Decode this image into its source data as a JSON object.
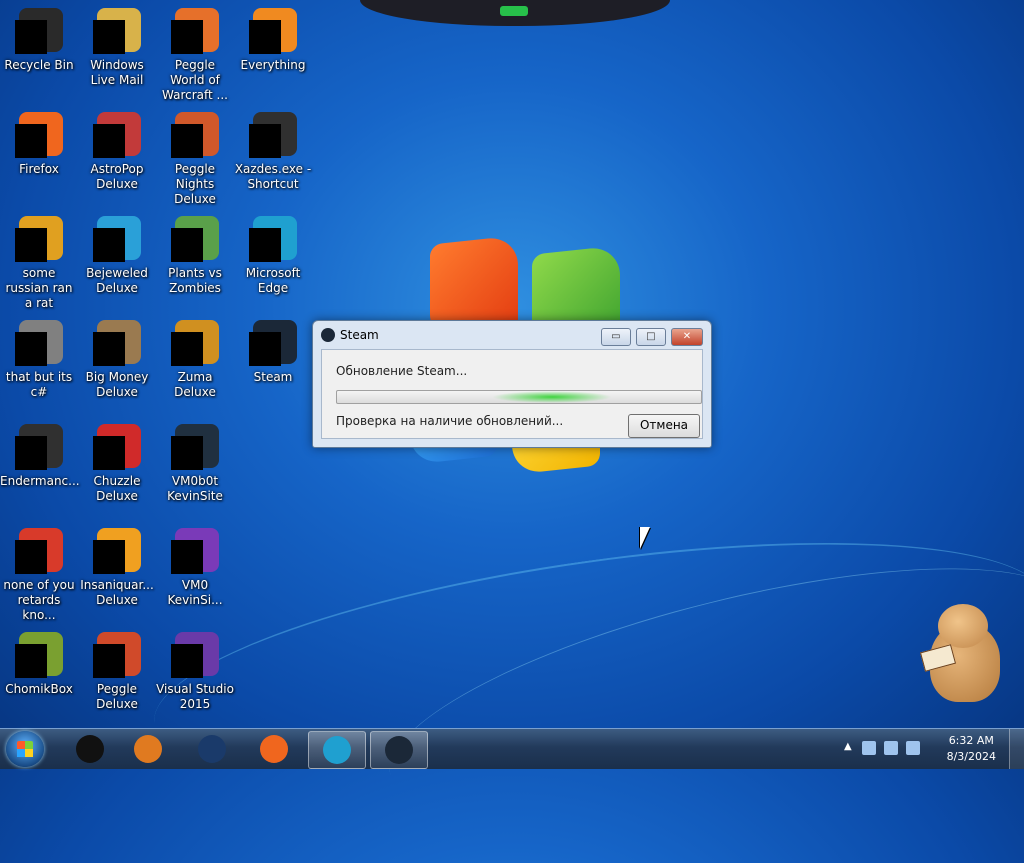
{
  "desktop_icons": [
    {
      "label": "Recycle Bin",
      "color": "#2a2a2a",
      "icon": "recycle-bin"
    },
    {
      "label": "Windows Live Mail",
      "color": "#d8b24a",
      "icon": "mail"
    },
    {
      "label": "Peggle World of Warcraft ...",
      "color": "#e6702a",
      "icon": "peggle"
    },
    {
      "label": "Everything",
      "color": "#f08a20",
      "icon": "everything"
    },
    {
      "label": "Firefox",
      "color": "#f0661e",
      "icon": "firefox"
    },
    {
      "label": "AstroPop Deluxe",
      "color": "#c23a3a",
      "icon": "astropop"
    },
    {
      "label": "Peggle Nights Deluxe",
      "color": "#d0582a",
      "icon": "peggle-nights"
    },
    {
      "label": "Xazdes.exe - Shortcut",
      "color": "#303030",
      "icon": "shortcut"
    },
    {
      "label": "some russian ran a rat",
      "color": "#e0a020",
      "icon": "file"
    },
    {
      "label": "Bejeweled Deluxe",
      "color": "#2aa0d8",
      "icon": "bejeweled"
    },
    {
      "label": "Plants vs Zombies",
      "color": "#5aa04a",
      "icon": "pvz"
    },
    {
      "label": "Microsoft Edge",
      "color": "#1fa0d0",
      "icon": "edge"
    },
    {
      "label": "that but its c#",
      "color": "#808080",
      "icon": "file"
    },
    {
      "label": "Big Money Deluxe",
      "color": "#9a7a50",
      "icon": "bigmoney"
    },
    {
      "label": "Zuma Deluxe",
      "color": "#d09020",
      "icon": "zuma"
    },
    {
      "label": "Steam",
      "color": "#1b2838",
      "icon": "steam"
    },
    {
      "label": "Endermanc...",
      "color": "#303030",
      "icon": "console"
    },
    {
      "label": "Chuzzle Deluxe",
      "color": "#d02a2a",
      "icon": "chuzzle"
    },
    {
      "label": "VM0b0t KevinSite",
      "color": "#203040",
      "icon": "vm"
    },
    {
      "label": "",
      "color": "transparent",
      "icon": "none"
    },
    {
      "label": "none of you retards kno...",
      "color": "#d83a2a",
      "icon": "app"
    },
    {
      "label": "Insaniquar... Deluxe",
      "color": "#f0a020",
      "icon": "insaniquarium"
    },
    {
      "label": "VM0 KevinSi...",
      "color": "#7a3ab8",
      "icon": "vm"
    },
    {
      "label": "",
      "color": "transparent",
      "icon": "none"
    },
    {
      "label": "ChomikBox",
      "color": "#7aa030",
      "icon": "chomikbox"
    },
    {
      "label": "Peggle Deluxe",
      "color": "#d04a2a",
      "icon": "peggle"
    },
    {
      "label": "Visual Studio 2015",
      "color": "#6a3aa8",
      "icon": "visual-studio"
    }
  ],
  "dialog": {
    "title": "Steam",
    "status": "Обновление Steam...",
    "check_text": "Проверка на наличие обновлений...",
    "cancel_label": "Отмена",
    "minimize_glyph": "▭",
    "maximize_glyph": "□",
    "close_glyph": "✕"
  },
  "taskbar": {
    "items": [
      {
        "name": "explorer",
        "color": "#111111",
        "icon": "explorer-icon"
      },
      {
        "name": "media-player",
        "color": "#e07a20",
        "icon": "media-player-icon"
      },
      {
        "name": "app-globe",
        "color": "#1a3a6a",
        "icon": "globe-icon"
      },
      {
        "name": "firefox",
        "color": "#f0661e",
        "icon": "firefox-icon"
      },
      {
        "name": "edge",
        "color": "#1fa0d0",
        "icon": "edge-icon"
      },
      {
        "name": "steam",
        "color": "#1b2838",
        "icon": "steam-icon"
      }
    ],
    "tray_arrow": "▲",
    "time": "6:32 AM",
    "date": "8/3/2024"
  }
}
